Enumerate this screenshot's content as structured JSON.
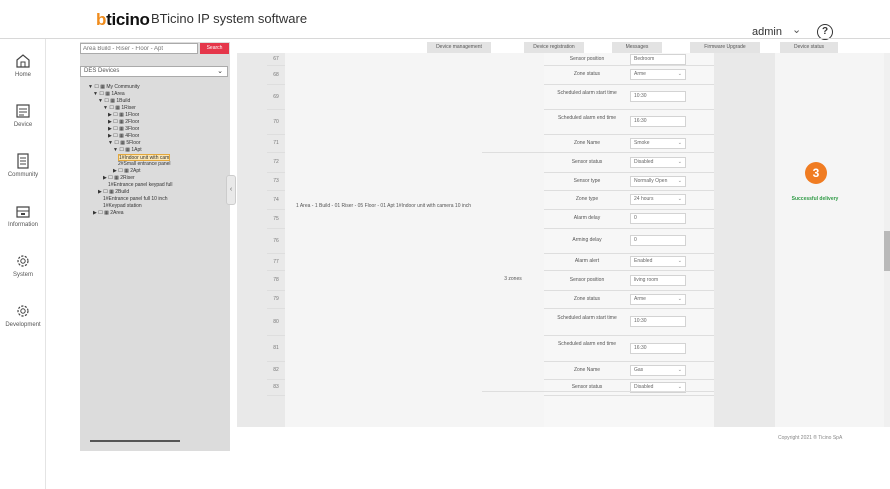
{
  "header": {
    "logo": "bticino",
    "title": "BTicino IP system software",
    "user": "admin",
    "user_chevron": "⌄",
    "help": "?"
  },
  "nav": [
    {
      "label": "Home",
      "icon": "home-icon"
    },
    {
      "label": "Device",
      "icon": "device-icon"
    },
    {
      "label": "Community",
      "icon": "community-icon"
    },
    {
      "label": "Information",
      "icon": "information-icon"
    },
    {
      "label": "System",
      "icon": "system-gear-icon"
    },
    {
      "label": "Development",
      "icon": "development-gear-icon"
    }
  ],
  "tree_panel": {
    "search_placeholder": "Area Build - Riser - Floor - Apt",
    "search_button": "Search",
    "devices_select": "DES Devices",
    "nodes": [
      {
        "label": "▼ ☐ ▦ My Community",
        "indent": 0
      },
      {
        "label": "▼ ☐ ▦ 1Area",
        "indent": 1
      },
      {
        "label": "▼ ☐ ▦ 1Build",
        "indent": 2
      },
      {
        "label": "▼ ☐ ▦ 1Riser",
        "indent": 3
      },
      {
        "label": "▶ ☐ ▦ 1Floor",
        "indent": 4
      },
      {
        "label": "▶ ☐ ▦ 2Floor",
        "indent": 4
      },
      {
        "label": "▶ ☐ ▦ 3Floor",
        "indent": 4
      },
      {
        "label": "▶ ☐ ▦ 4Floor",
        "indent": 4
      },
      {
        "label": "▼ ☐ ▦ 5Floor",
        "indent": 4
      },
      {
        "label": "▼ ☐ ▦ 1Apt",
        "indent": 5
      },
      {
        "label": "1#Indoor unit with cam",
        "indent": 6,
        "selected": true
      },
      {
        "label": "2#Small entrance panel",
        "indent": 6
      },
      {
        "label": "▶ ☐ ▦ 2Apt",
        "indent": 5
      },
      {
        "label": "▶ ☐ ▦ 2Riser",
        "indent": 3
      },
      {
        "label": "1#Entrance panel keypad full",
        "indent": 4
      },
      {
        "label": "▶ ☐ ▦ 2Build",
        "indent": 2
      },
      {
        "label": "1#Entrance panel full 10 inch",
        "indent": 3
      },
      {
        "label": "1#Keypad station",
        "indent": 3
      },
      {
        "label": "▶ ☐ ▦ 2Area",
        "indent": 1
      }
    ]
  },
  "toolbar": [
    {
      "label": "Device management"
    },
    {
      "label": "Device registration"
    },
    {
      "label": "Messages"
    },
    {
      "label": "Firmware Upgrade"
    },
    {
      "label": "Device status"
    }
  ],
  "table": {
    "row_numbers": [
      "67",
      "68",
      "69",
      "70",
      "71",
      "72",
      "73",
      "74",
      "75",
      "76",
      "77",
      "78",
      "79",
      "80",
      "81",
      "82",
      "83"
    ],
    "device": "1 Area - 1 Build - 01 Riser - 05 Floor - 01 Apt 1#Indoor unit with camera 10 inch",
    "zones": "3 zones",
    "params": [
      {
        "label": "Sensor position",
        "value": "Bedroom",
        "dropdown": false
      },
      {
        "label": "Zone status",
        "value": "Arme",
        "dropdown": true
      },
      {
        "label": "Scheduled alarm start time",
        "value": "10:30",
        "dropdown": false
      },
      {
        "label": "Scheduled alarm end time",
        "value": "16:30",
        "dropdown": false
      },
      {
        "label": "Zone Name",
        "value": "Smoke",
        "dropdown": true
      },
      {
        "label": "Sensor status",
        "value": "Disabled",
        "dropdown": true
      },
      {
        "label": "Sensor type",
        "value": "Normally Open",
        "dropdown": true
      },
      {
        "label": "Zone type",
        "value": "24 hours",
        "dropdown": true
      },
      {
        "label": "Alarm delay",
        "value": "0",
        "dropdown": false
      },
      {
        "label": "Arming delay",
        "value": "0",
        "dropdown": false
      },
      {
        "label": "Alarm alert",
        "value": "Enabled",
        "dropdown": true
      },
      {
        "label": "Sensor position",
        "value": "living room",
        "dropdown": false
      },
      {
        "label": "Zone status",
        "value": "Arme",
        "dropdown": true
      },
      {
        "label": "Scheduled alarm start time",
        "value": "10:30",
        "dropdown": false
      },
      {
        "label": "Scheduled alarm end time",
        "value": "16:30",
        "dropdown": false
      },
      {
        "label": "Zone Name",
        "value": "Gas",
        "dropdown": true
      },
      {
        "label": "Sensor status",
        "value": "Disabled",
        "dropdown": true
      }
    ],
    "status_badge": "3",
    "status_text": "Successful delivery"
  },
  "footer": {
    "copyright": "Copyright 2021 ® Ticino SpA"
  },
  "colors": {
    "accent_orange": "#f07c22",
    "search_red": "#e5364a",
    "success_green": "#2e9a45",
    "tree_selected": "#fbe6b4"
  }
}
